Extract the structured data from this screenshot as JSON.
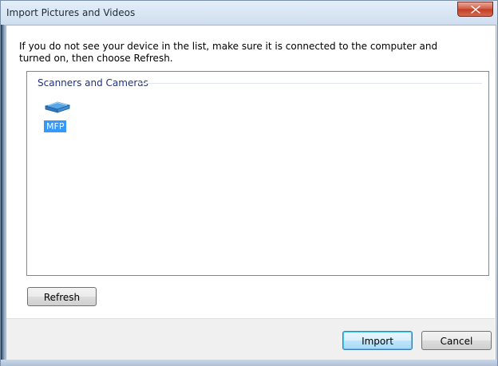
{
  "window": {
    "title": "Import Pictures and Videos"
  },
  "instructions": "If you do not see your device in the list, make sure it is connected to the computer and turned on, then choose Refresh.",
  "device_list": {
    "group_header": "Scanners and Cameras",
    "devices": [
      {
        "label": "MFP",
        "icon": "scanner-icon",
        "selected": true
      }
    ]
  },
  "buttons": {
    "refresh": "Refresh",
    "import": "Import",
    "cancel": "Cancel"
  },
  "colors": {
    "selection": "#3399ff",
    "group_header": "#1e3287",
    "close_button": "#c23b24"
  }
}
